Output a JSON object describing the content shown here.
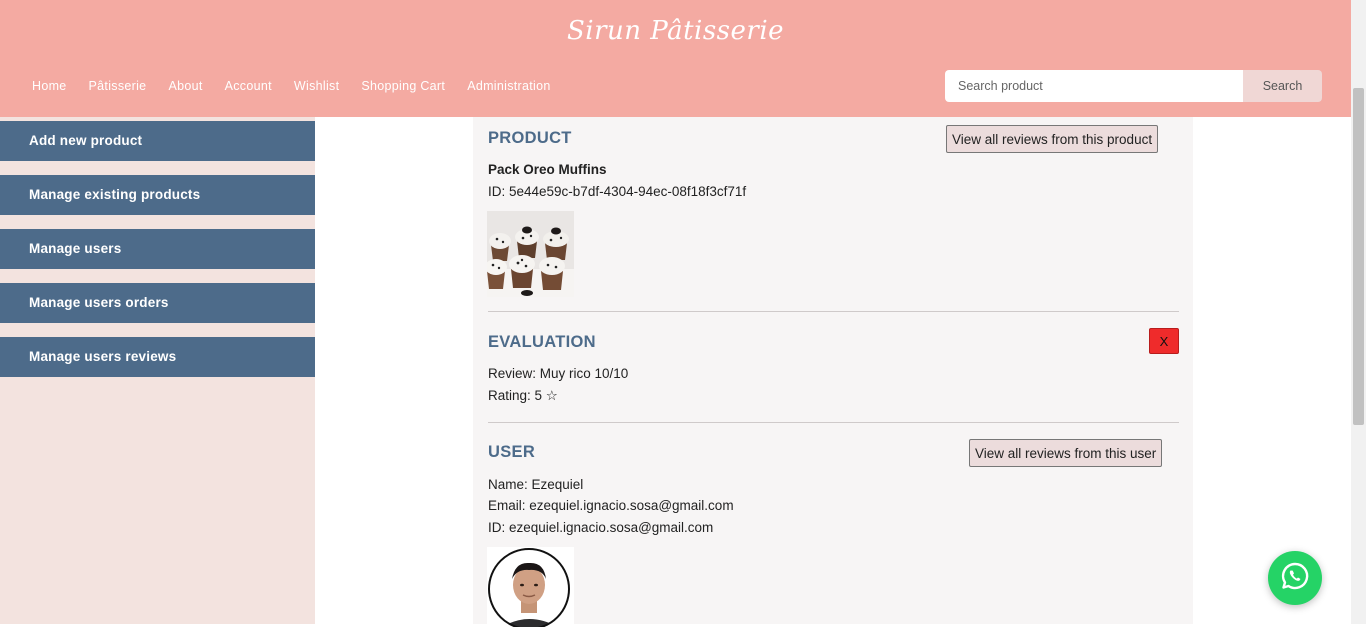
{
  "header": {
    "brand": "Sirun Pâtisserie",
    "nav": [
      "Home",
      "Pâtisserie",
      "About",
      "Account",
      "Wishlist",
      "Shopping Cart",
      "Administration"
    ],
    "search": {
      "placeholder": "Search product",
      "button": "Search"
    }
  },
  "sidebar": {
    "items": [
      "Add new product",
      "Manage existing products",
      "Manage users",
      "Manage users orders",
      "Manage users reviews"
    ]
  },
  "product": {
    "title": "PRODUCT",
    "view_button": "View all reviews from this product",
    "name": "Pack Oreo Muffins",
    "id_text": "ID: 5e44e59c-b7df-4304-94ec-08f18f3cf71f"
  },
  "evaluation": {
    "title": "EVALUATION",
    "delete_label": "X",
    "review_text": "Review: Muy rico 10/10",
    "rating_text": "Rating: 5 ☆"
  },
  "user": {
    "title": "USER",
    "view_button": "View all reviews from this user",
    "name_text": "Name: Ezequiel",
    "email_text": "Email: ezequiel.ignacio.sosa@gmail.com",
    "id_text": "ID: ezequiel.ignacio.sosa@gmail.com"
  },
  "colors": {
    "header_bg": "#f4aaa2",
    "sidebar_bg": "#f3e3df",
    "sidebar_button": "#4d6b8a",
    "section_title": "#4d6b8a",
    "delete_button": "#ef2b2b",
    "whatsapp": "#25d366"
  },
  "icons": {
    "whatsapp": "whatsapp-icon"
  }
}
